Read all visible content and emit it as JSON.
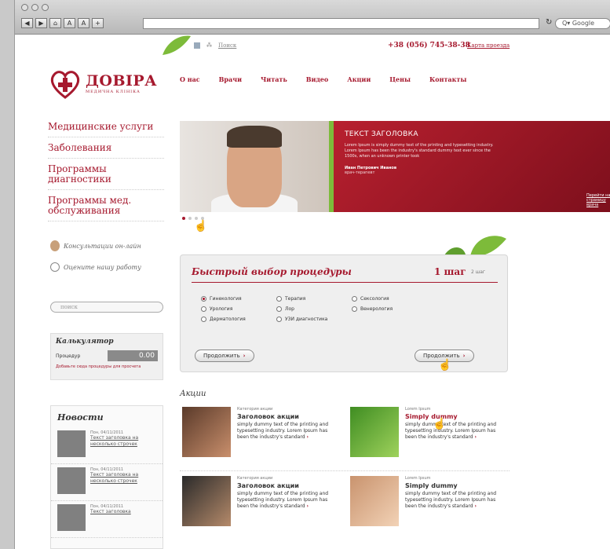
{
  "browser": {
    "nav_buttons": [
      "◀",
      "▶",
      "⌂",
      "A",
      "A",
      "+"
    ],
    "reload_icon": "reload-icon",
    "search_placeholder": "Q▾ Google"
  },
  "header": {
    "util_links": [
      "Поиск"
    ],
    "phone": "+38 (056) 745-38-38",
    "map_link": "Карта проезда",
    "logo_name": "ДОВІРА",
    "logo_sub": "МЕДИЧНА КЛІНІКА",
    "nav": [
      "О нас",
      "Врачи",
      "Читать",
      "Видео",
      "Акции",
      "Цены",
      "Контакты"
    ]
  },
  "sidebar": {
    "items": [
      "Медицинские услуги",
      "Заболевания",
      "Программы диагностики",
      "Программы мед. обслуживания"
    ],
    "consult": "Консультации он-лайн",
    "rate": "Оцените нашу работу",
    "search_placeholder": "поиск",
    "calc": {
      "title": "Калькулятор",
      "label": "Процедур",
      "value": "0.00",
      "link": "Добавьте сюда процедуры для просчета"
    },
    "news": {
      "title": "Новости",
      "items": [
        {
          "date": "Пон, 04/11/2011",
          "text": "Текст заголовка на несколько строчек"
        },
        {
          "date": "Пон, 04/11/2011",
          "text": "Текст заголовка на несколько строчек"
        },
        {
          "date": "Пон, 04/11/2011",
          "text": "Текст заголовка"
        }
      ]
    }
  },
  "banner": {
    "title": "ТЕКСТ ЗАГОЛОВКА",
    "text": "Lorem Ipsum is simply dummy text of the printing and typesetting industry. Lorem Ipsum has been the industry's standard dummy text ever since the 1500s, when an unknown printer took",
    "name": "Иван Петрович Иванов",
    "role": "врач-терапевт",
    "link": "Перейти на страницу врача"
  },
  "quick": {
    "title": "Быстрый выбор процедуры",
    "step1": "1 шаг",
    "step2": "2 шаг",
    "col1": [
      "Гинекология",
      "Урология",
      "Дерматология"
    ],
    "col2": [
      "Терапия",
      "Лор",
      "УЗИ диагностика"
    ],
    "col3": [
      "Сексология",
      "Венерология"
    ],
    "btn_left": "Продолжить",
    "btn_right": "Продолжить"
  },
  "akcii": {
    "title": "Акции",
    "items": [
      {
        "cat": "Категория акции",
        "title": "Заголовок акции",
        "text": "simply dummy text of the printing and typesetting industry. Lorem Ipsum has been the industry's standard"
      },
      {
        "cat": "Lorem Ipsum",
        "title": "Simply dummy",
        "text": "simply dummy text of the printing and typesetting industry. Lorem Ipsum has been the industry's standard"
      },
      {
        "cat": "Категория акции",
        "title": "Заголовок акции",
        "text": "simply dummy text of the printing and typesetting industry. Lorem Ipsum has been the industry's standard"
      },
      {
        "cat": "Lorem Ipsum",
        "title": "Simply dummy",
        "text": "simply dummy text of the printing and typesetting industry. Lorem Ipsum has been the industry's standard"
      }
    ]
  },
  "colors": {
    "brand": "#a6192e",
    "accent_green": "#7dbb3a"
  }
}
